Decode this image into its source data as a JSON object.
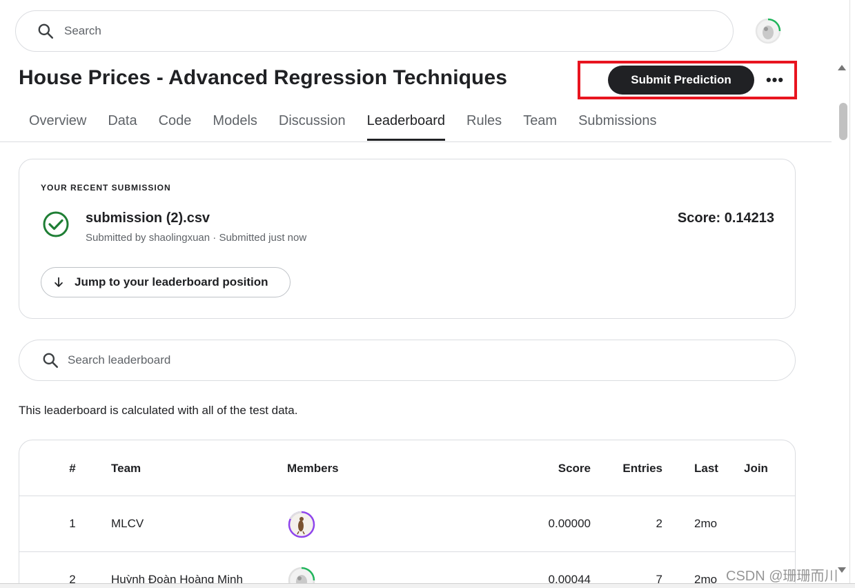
{
  "search": {
    "placeholder": "Search"
  },
  "header": {
    "title": "House Prices - Advanced Regression Techniques",
    "submit_label": "Submit Prediction",
    "more_label": "•••"
  },
  "tabs": [
    {
      "label": "Overview",
      "active": false
    },
    {
      "label": "Data",
      "active": false
    },
    {
      "label": "Code",
      "active": false
    },
    {
      "label": "Models",
      "active": false
    },
    {
      "label": "Discussion",
      "active": false
    },
    {
      "label": "Leaderboard",
      "active": true
    },
    {
      "label": "Rules",
      "active": false
    },
    {
      "label": "Team",
      "active": false
    },
    {
      "label": "Submissions",
      "active": false
    }
  ],
  "recent": {
    "label": "YOUR RECENT SUBMISSION",
    "file_name": "submission (2).csv",
    "submitted_info": "Submitted by shaolingxuan · Submitted just now",
    "score": "Score: 0.14213",
    "jump_label": "Jump to your leaderboard position"
  },
  "leaderboard": {
    "search_placeholder": "Search leaderboard",
    "note": "This leaderboard is calculated with all of the test data.",
    "columns": [
      "#",
      "Team",
      "Members",
      "Score",
      "Entries",
      "Last",
      "Join"
    ],
    "rows": [
      {
        "rank": "1",
        "team": "MLCV",
        "score": "0.00000",
        "entries": "2",
        "last": "2mo"
      },
      {
        "rank": "2",
        "team": "Huỳnh Đoàn Hoàng Minh",
        "score": "0.00044",
        "entries": "7",
        "last": "2mo"
      }
    ]
  },
  "watermark": "CSDN @珊珊而川",
  "colors": {
    "accent_red": "#e8141f",
    "success_green": "#1e7e34",
    "dark": "#202124",
    "avatar_ring_purple": "#8e44ec",
    "avatar_ring_green": "#20b55b"
  }
}
